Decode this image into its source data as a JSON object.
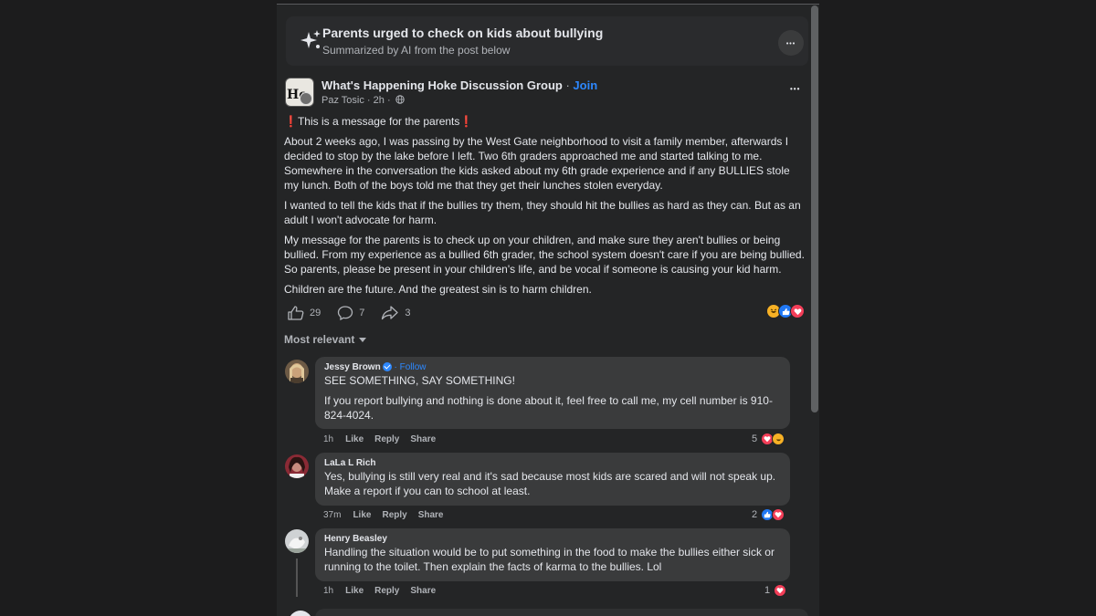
{
  "ai_summary": {
    "title": "Parents urged to check on kids about bullying",
    "subtitle": "Summarized by AI from the post below",
    "more_label": "•••"
  },
  "post": {
    "group_name": "What's Happening Hoke Discussion Group",
    "separator": " · ",
    "join_label": "Join",
    "avatar_text": "Ho",
    "author": "Paz Tosic",
    "time": " · 2h ·",
    "more_label": "•••",
    "headline_mark": "❗",
    "headline": "This is a message for the parents",
    "paragraphs": [
      "About 2 weeks ago, I was passing by the West Gate neighborhood to visit a family member, afterwards I decided to stop by the lake before I left. Two 6th graders approached me and started talking to me. Somewhere in the conversation the kids asked about my 6th grade experience and if any BULLIES stole my lunch. Both of the boys told me that they get their lunches stolen everyday.",
      "I wanted to tell the kids that if the bullies try them, they should hit the bullies as hard as they can. But as an adult I won't advocate for harm.",
      "My message for the parents is to check up on your children, and make sure they aren't bullies or being bullied. From my experience as a bullied 6th grader, the school system doesn't care if you are being bullied. So parents, please be present in your children's life, and be vocal if someone is causing your kid harm.",
      "Children are the future. And the greatest sin is to harm children."
    ],
    "like_count": "29",
    "comment_count": "7",
    "share_count": "3",
    "reactions": [
      "haha-icon",
      "like-icon",
      "love-icon"
    ]
  },
  "comments_sort": "Most relevant",
  "comments": [
    {
      "name": "Jessy Brown",
      "follow": " · Follow",
      "paragraphs": [
        "SEE SOMETHING, SAY SOMETHING!",
        "If you report bullying and nothing is done about it, feel free to call me, my cell number is 910-824-4024."
      ],
      "time": "1h",
      "like": "Like",
      "reply": "Reply",
      "share": "Share",
      "react_count": "5"
    },
    {
      "name": "LaLa L Rich",
      "paragraphs": [
        "Yes, bullying is still very real and it's sad because most kids are scared and will not speak up. Make a report if you can to school at least."
      ],
      "time": "37m",
      "like": "Like",
      "reply": "Reply",
      "share": "Share",
      "react_count": "2"
    },
    {
      "name": "Henry Beasley",
      "paragraphs": [
        "Handling the situation would be to put something in the food to make the bullies either sick or running to the toilet. Then explain the facts of karma to the bullies. Lol"
      ],
      "time": "1h",
      "like": "Like",
      "reply": "Reply",
      "share": "Share",
      "react_count": "1"
    }
  ],
  "colors": {
    "background": "#1c1c1d",
    "card": "#242526",
    "bubble": "#3a3b3c",
    "link": "#2d88ff",
    "love": "#f33e58",
    "like": "#2078f4",
    "haha": "#f7b125"
  }
}
